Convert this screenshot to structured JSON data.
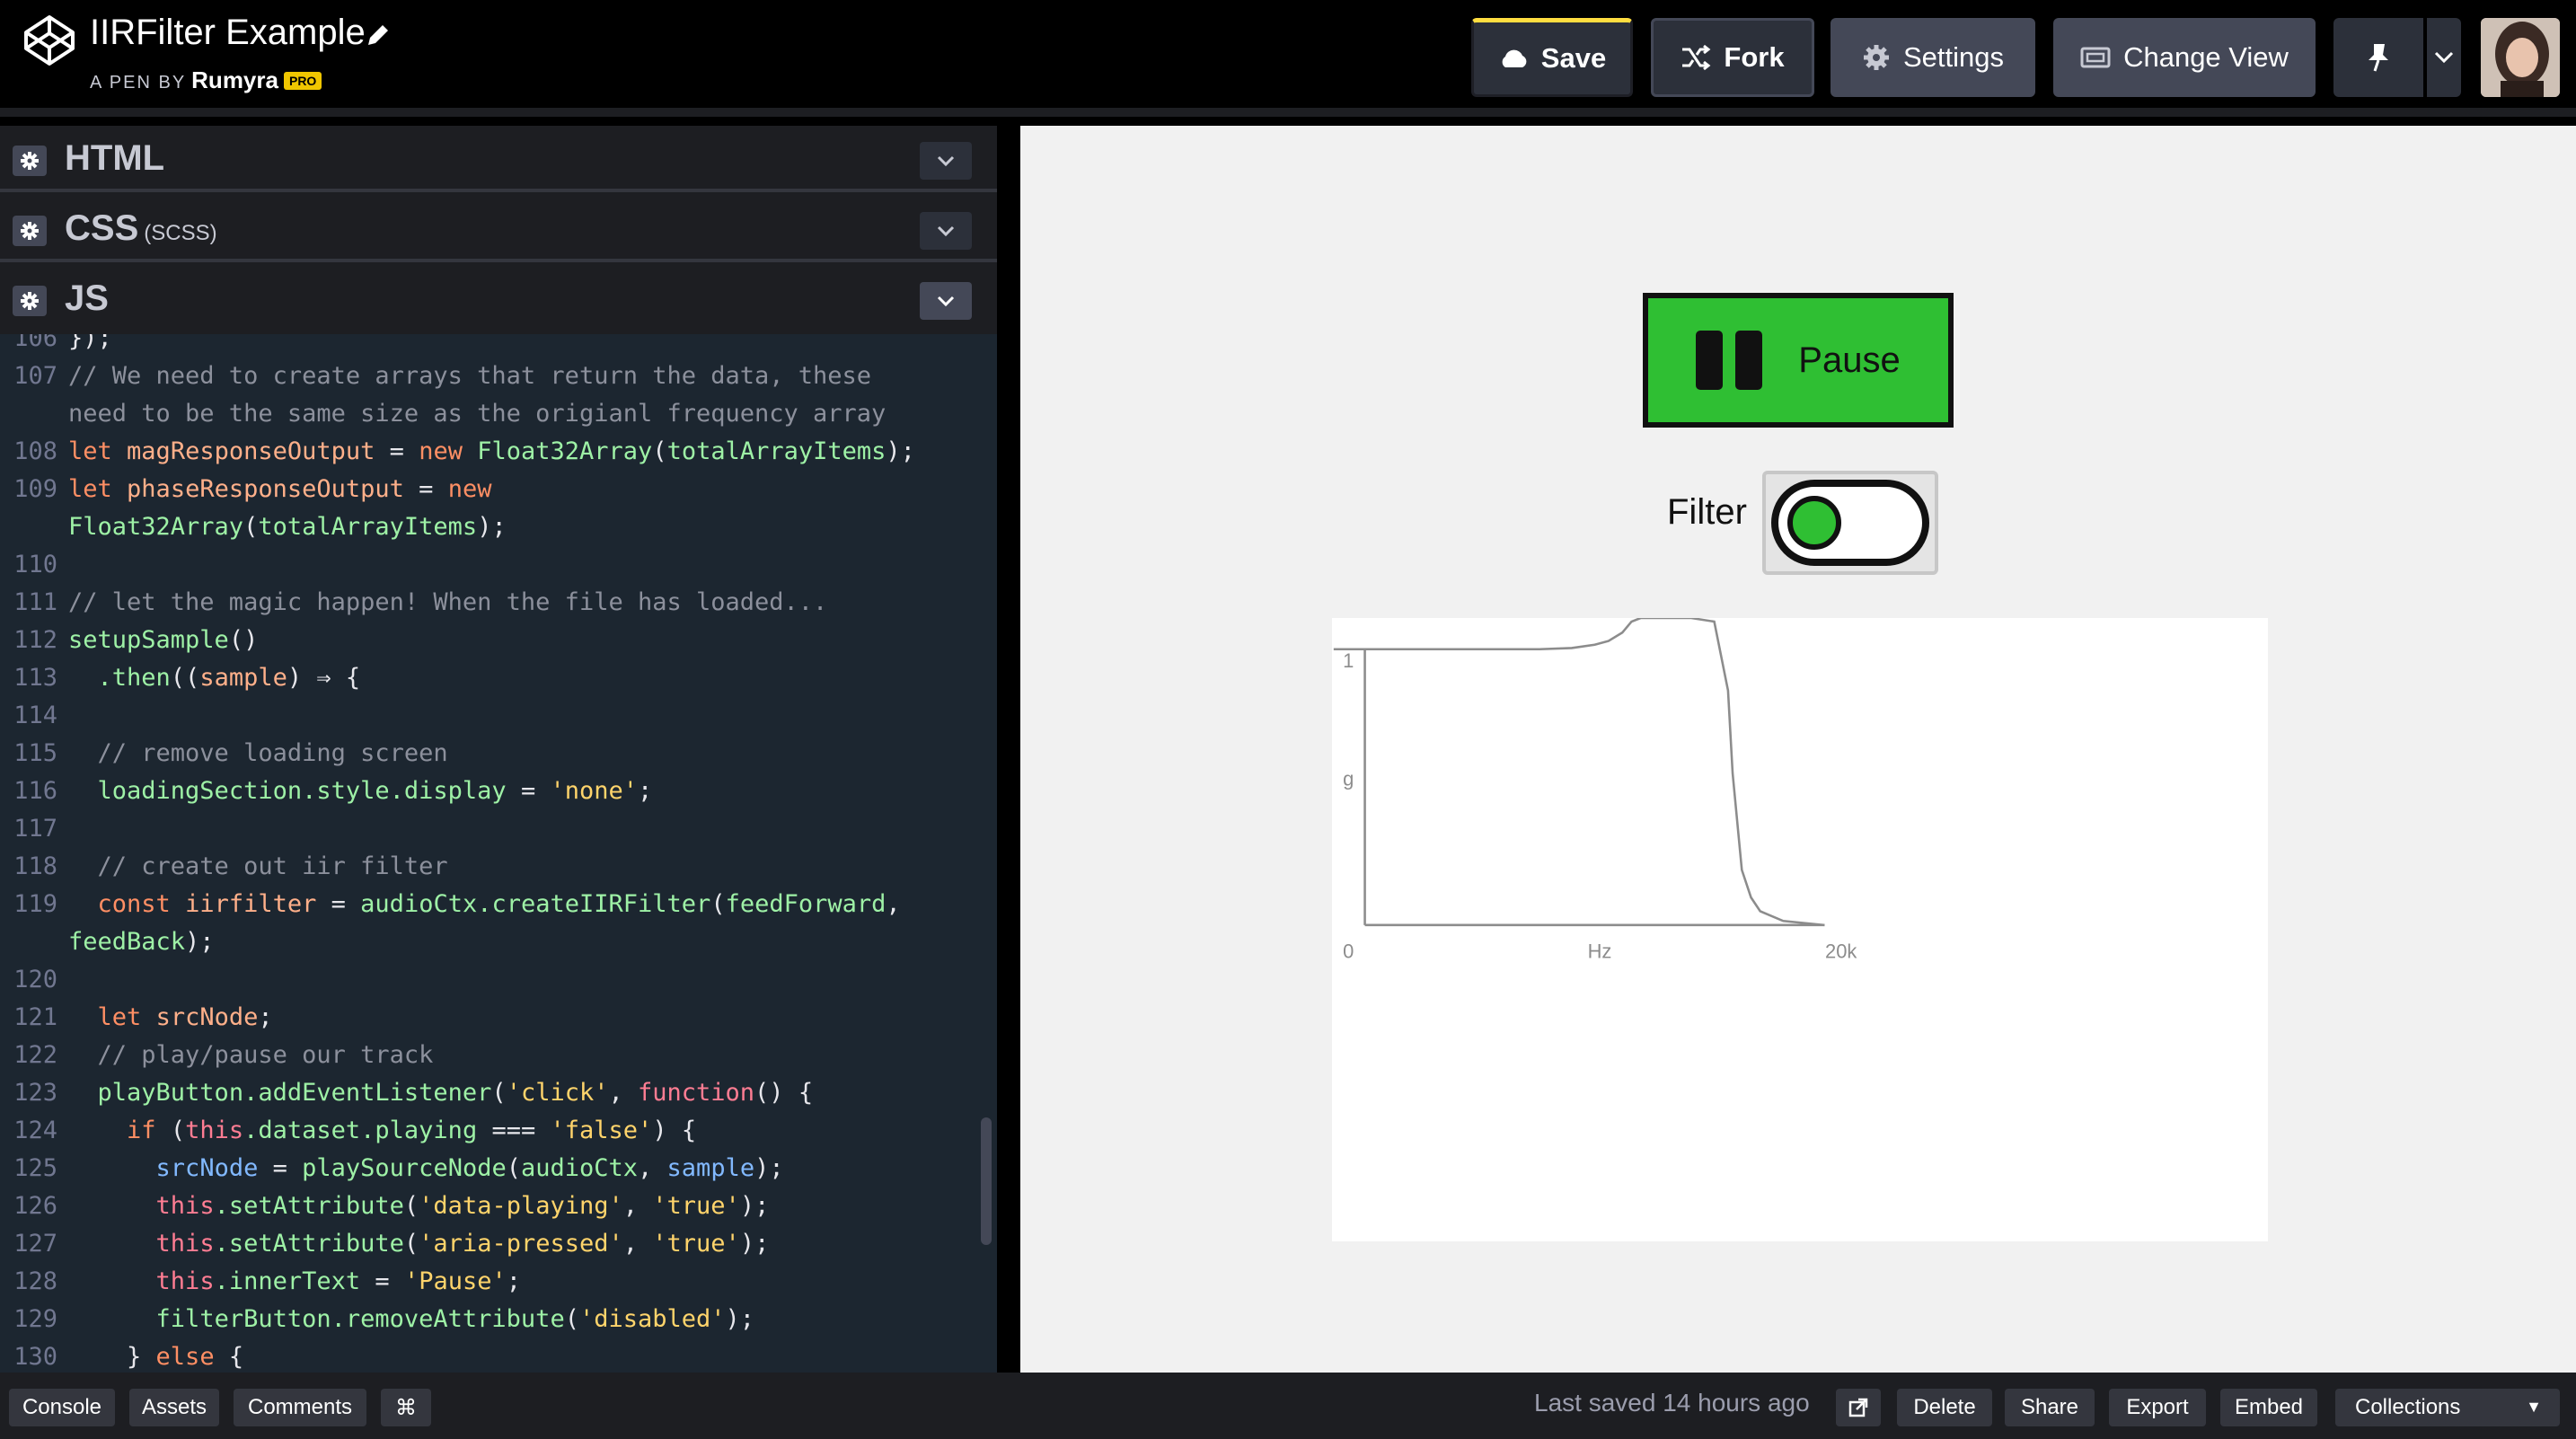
{
  "header": {
    "title": "IIRFilter Example",
    "by_label": "A PEN BY",
    "author": "Rumyra",
    "badge": "PRO",
    "buttons": {
      "save": "Save",
      "fork": "Fork",
      "settings": "Settings",
      "change_view": "Change View"
    },
    "accent_color": "#ffdd40"
  },
  "editor": {
    "panels": [
      {
        "name": "HTML",
        "preprocessor": ""
      },
      {
        "name": "CSS",
        "preprocessor": "(SCSS)"
      },
      {
        "name": "JS",
        "preprocessor": ""
      }
    ],
    "code_lines": [
      {
        "n": "106",
        "html": "<span class=\"pn\">});</span>"
      },
      {
        "n": "107",
        "html": "<span class=\"cm\">// We need to create arrays that return the data, these</span>"
      },
      {
        "n": "",
        "html": "<span class=\"cm\">need to be the same size as the origianl frequency array</span>"
      },
      {
        "n": "108",
        "html": "<span class=\"kw\">let</span> <span class=\"vr\">magResponseOutput</span> <span class=\"pn\">=</span> <span class=\"kw\">new</span> <span class=\"fn\">Float32Array</span><span class=\"pn\">(</span><span class=\"fn\">totalArrayItems</span><span class=\"pn\">);</span>"
      },
      {
        "n": "109",
        "html": "<span class=\"kw\">let</span> <span class=\"vr\">phaseResponseOutput</span> <span class=\"pn\">=</span> <span class=\"kw\">new</span>"
      },
      {
        "n": "",
        "html": "<span class=\"fn\">Float32Array</span><span class=\"pn\">(</span><span class=\"fn\">totalArrayItems</span><span class=\"pn\">);</span>"
      },
      {
        "n": "110",
        "html": ""
      },
      {
        "n": "111",
        "html": "<span class=\"cm\">// let the magic happen! When the file has loaded...</span>"
      },
      {
        "n": "112",
        "html": "<span class=\"fn\">setupSample</span><span class=\"pn\">()</span>"
      },
      {
        "n": "113",
        "html": "  <span class=\"fn\">.then</span><span class=\"pn\">((</span><span class=\"vr\">sample</span><span class=\"pn\">) ⇒ {</span>"
      },
      {
        "n": "114",
        "html": ""
      },
      {
        "n": "115",
        "html": "  <span class=\"cm\">// remove loading screen</span>"
      },
      {
        "n": "116",
        "html": "  <span class=\"fn\">loadingSection.style.display</span> <span class=\"pn\">=</span> <span class=\"st\">'none'</span><span class=\"pn\">;</span>"
      },
      {
        "n": "117",
        "html": ""
      },
      {
        "n": "118",
        "html": "  <span class=\"cm\">// create out iir filter</span>"
      },
      {
        "n": "119",
        "html": "  <span class=\"kw\">const</span> <span class=\"vr\">iirfilter</span> <span class=\"pn\">=</span> <span class=\"fn\">audioCtx.createIIRFilter</span><span class=\"pn\">(</span><span class=\"fn\">feedForward</span><span class=\"pn\">,</span>"
      },
      {
        "n": "",
        "html": "<span class=\"fn\">feedBack</span><span class=\"pn\">);</span>"
      },
      {
        "n": "120",
        "html": ""
      },
      {
        "n": "121",
        "html": "  <span class=\"kw\">let</span> <span class=\"vr\">srcNode</span><span class=\"pn\">;</span>"
      },
      {
        "n": "122",
        "html": "  <span class=\"cm\">// play/pause our track</span>"
      },
      {
        "n": "123",
        "html": "  <span class=\"fn\">playButton.addEventListener</span><span class=\"pn\">(</span><span class=\"st\">'click'</span><span class=\"pn\">, </span><span class=\"th\">function</span><span class=\"pn\">() {</span>"
      },
      {
        "n": "124",
        "html": "    <span class=\"kw\">if</span> <span class=\"pn\">(</span><span class=\"th\">this</span><span class=\"fn\">.dataset.playing</span> <span class=\"pn\">===</span> <span class=\"st\">'false'</span><span class=\"pn\">) {</span>"
      },
      {
        "n": "125",
        "html": "      <span class=\"bl\">srcNode</span> <span class=\"pn\">=</span> <span class=\"fn\">playSourceNode</span><span class=\"pn\">(</span><span class=\"fn\">audioCtx</span><span class=\"pn\">, </span><span class=\"bl\">sample</span><span class=\"pn\">);</span>"
      },
      {
        "n": "126",
        "html": "      <span class=\"th\">this</span><span class=\"fn\">.setAttribute</span><span class=\"pn\">(</span><span class=\"st\">'data-playing'</span><span class=\"pn\">, </span><span class=\"st\">'true'</span><span class=\"pn\">);</span>"
      },
      {
        "n": "127",
        "html": "      <span class=\"th\">this</span><span class=\"fn\">.setAttribute</span><span class=\"pn\">(</span><span class=\"st\">'aria-pressed'</span><span class=\"pn\">, </span><span class=\"st\">'true'</span><span class=\"pn\">);</span>"
      },
      {
        "n": "128",
        "html": "      <span class=\"th\">this</span><span class=\"fn\">.innerText</span> <span class=\"pn\">=</span> <span class=\"st\">'Pause'</span><span class=\"pn\">;</span>"
      },
      {
        "n": "129",
        "html": "      <span class=\"fn\">filterButton.removeAttribute</span><span class=\"pn\">(</span><span class=\"st\">'disabled'</span><span class=\"pn\">);</span>"
      },
      {
        "n": "130",
        "html": "    <span class=\"pn\">} </span><span class=\"kw\">else</span> <span class=\"pn\">{</span>"
      }
    ]
  },
  "preview": {
    "pause_label": "Pause",
    "filter_label": "Filter",
    "filter_on": true,
    "button_color": "#2fbf33"
  },
  "chart_data": {
    "type": "line",
    "title": "",
    "xlabel": "Hz",
    "ylabel": "g",
    "x_tick_labels": [
      "0",
      "20k"
    ],
    "y_tick_labels": [
      "0",
      "1"
    ],
    "xlim": [
      0,
      1
    ],
    "ylim": [
      0,
      1.1
    ],
    "grid": false,
    "series": [
      {
        "x": [
          0,
          0.25,
          0.38,
          0.45,
          0.5,
          0.53,
          0.56,
          0.58,
          0.6,
          0.66,
          0.71,
          0.76,
          0.79,
          0.8,
          0.82,
          0.84,
          0.86,
          0.91,
          1.0
        ],
        "y": [
          1.0,
          1.0,
          1.0,
          1.004,
          1.016,
          1.03,
          1.06,
          1.1,
          1.2,
          1.6,
          1.6,
          1.1,
          0.85,
          0.55,
          0.2,
          0.1,
          0.05,
          0.015,
          0.0
        ],
        "color": "#8c8c8c"
      }
    ]
  },
  "footer": {
    "console": "Console",
    "assets": "Assets",
    "comments": "Comments",
    "shortcut": "⌘",
    "last_saved": "Last saved 14 hours ago",
    "delete": "Delete",
    "share": "Share",
    "export": "Export",
    "embed": "Embed",
    "collections": "Collections"
  }
}
